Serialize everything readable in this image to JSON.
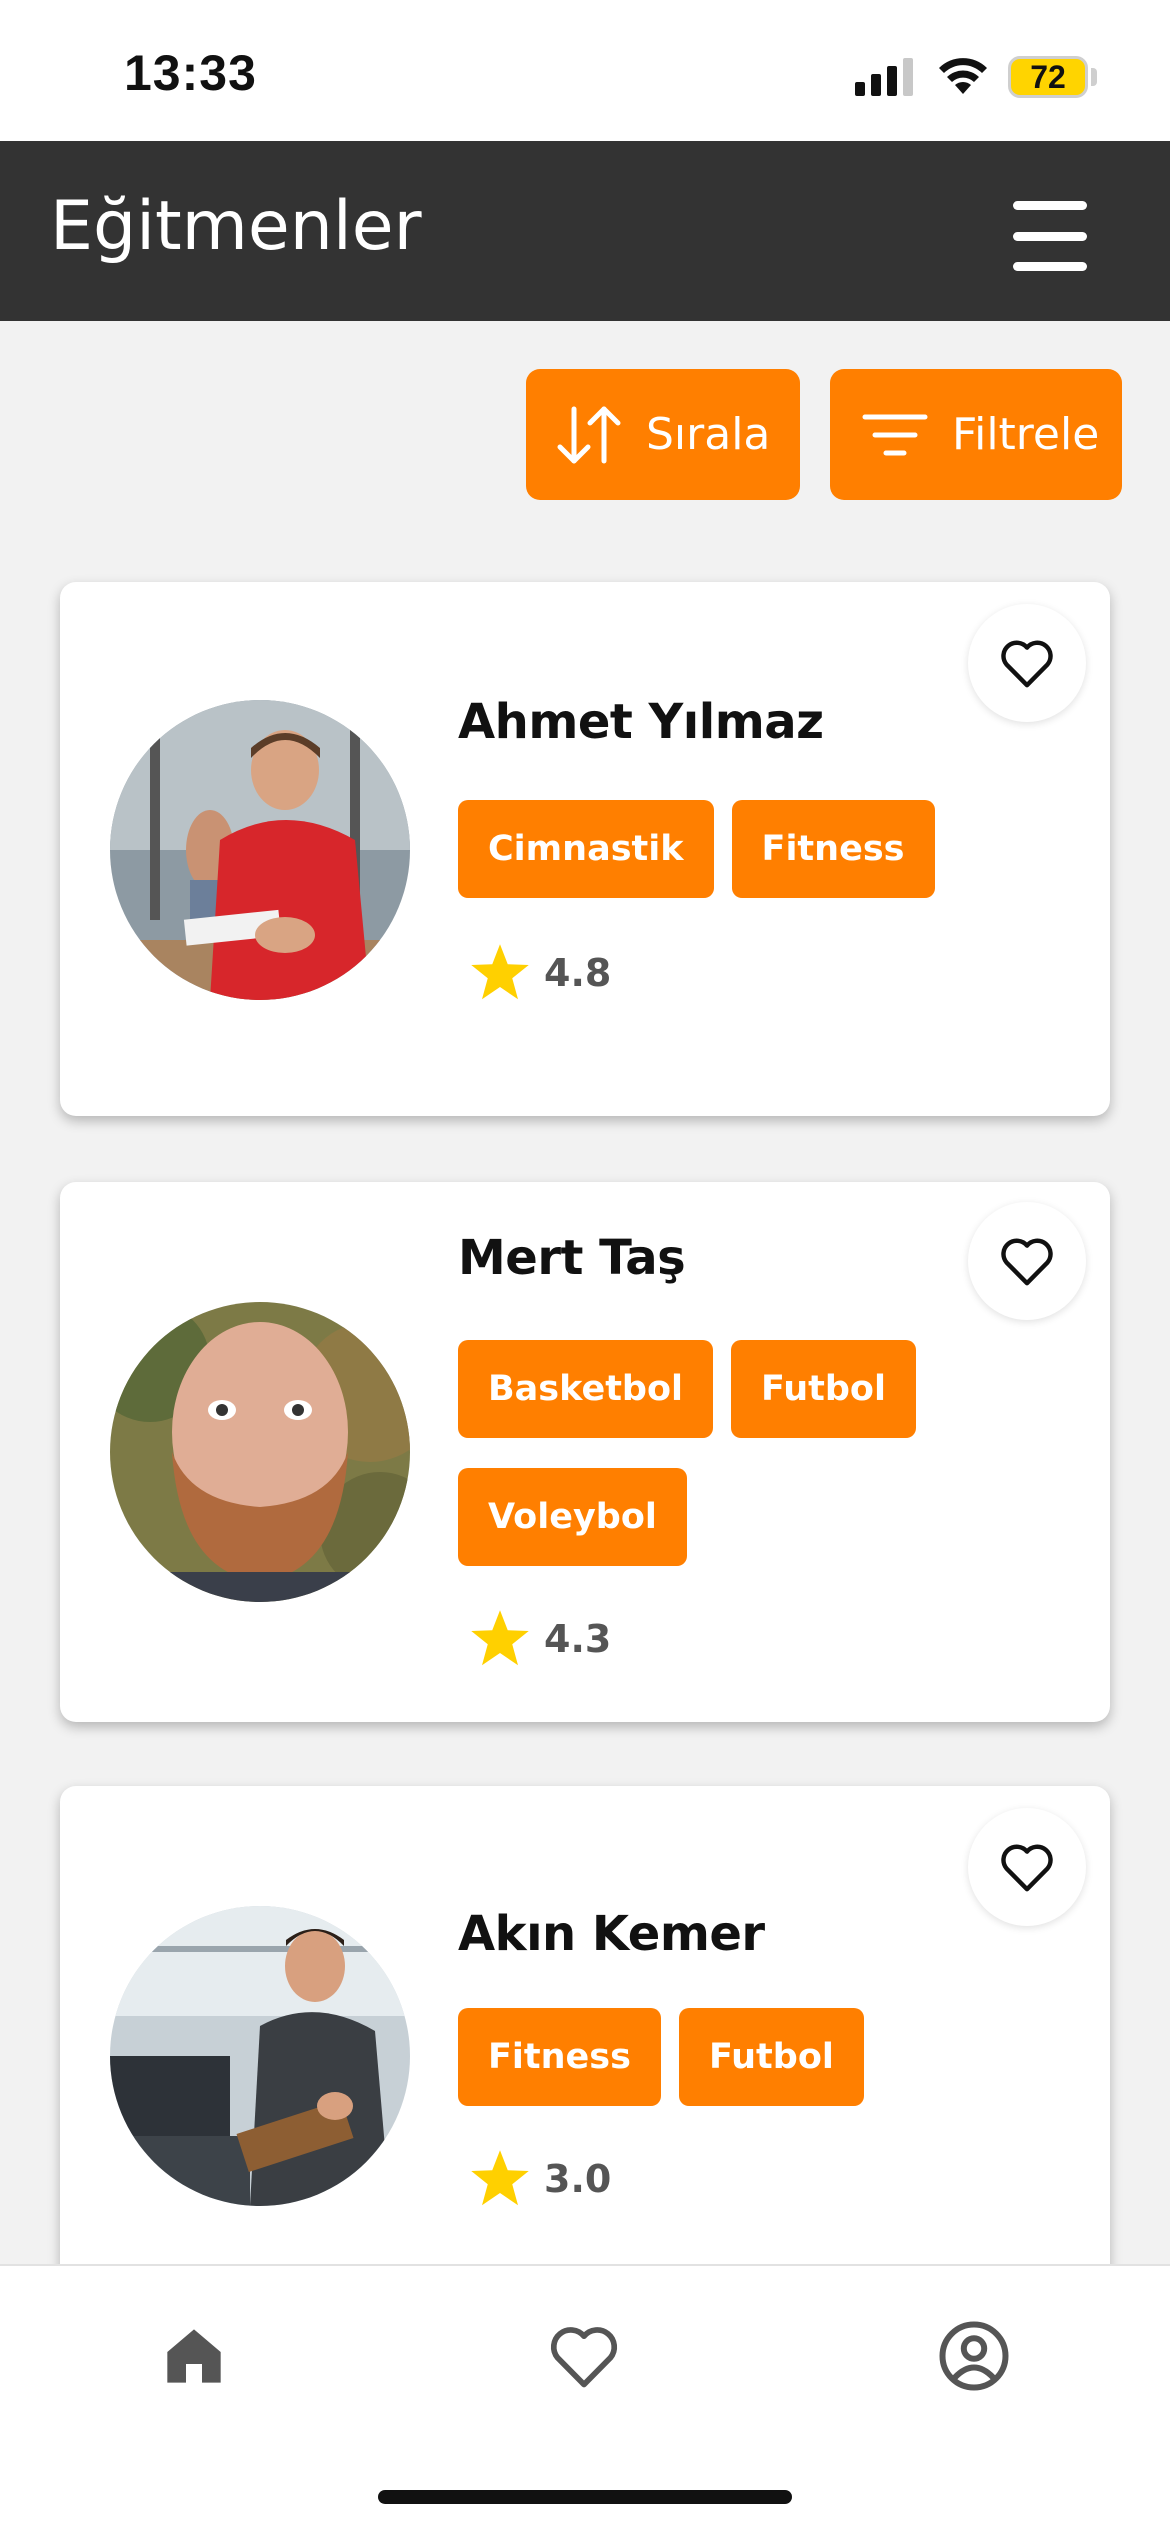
{
  "status_bar": {
    "time": "13:33",
    "battery": "72"
  },
  "header": {
    "title": "Eğitmenler"
  },
  "toolbar": {
    "sort_label": "Sırala",
    "filter_label": "Filtrele"
  },
  "trainers": [
    {
      "name": "Ahmet Yılmaz",
      "tags": [
        "Cimnastik",
        "Fitness"
      ],
      "rating": "4.8"
    },
    {
      "name": "Mert Taş",
      "tags": [
        "Basketbol",
        "Futbol",
        "Voleybol"
      ],
      "rating": "4.3"
    },
    {
      "name": "Akın Kemer",
      "tags": [
        "Fitness",
        "Futbol"
      ],
      "rating": "3.0"
    }
  ],
  "icons": {
    "sort": "sort-arrows-icon",
    "filter": "filter-lines-icon",
    "favorite": "heart-outline-icon",
    "rating": "star-icon",
    "nav_home": "home-icon",
    "nav_favorites": "heart-outline-icon",
    "nav_profile": "user-circle-icon"
  },
  "colors": {
    "accent": "#ff7f00",
    "header_bg": "#333333",
    "star": "#ffd000",
    "page_bg": "#f2f2f2"
  }
}
